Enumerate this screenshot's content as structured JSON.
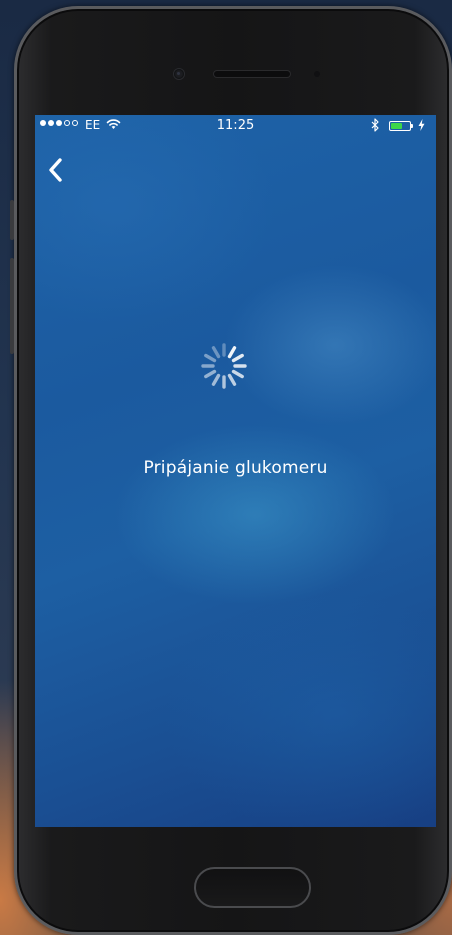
{
  "status_bar": {
    "signal_filled": 3,
    "signal_total": 5,
    "carrier": "EE",
    "time": "11:25",
    "battery_level": 0.6,
    "battery_color": "#3cd64a",
    "icons": [
      "wifi-icon",
      "bluetooth-icon",
      "battery-icon",
      "charging-bolt-icon"
    ]
  },
  "nav": {
    "back_icon": "chevron-left-icon"
  },
  "main": {
    "spinner_icon": "loading-spinner-icon",
    "status_text": "Pripájanie glukomeru"
  },
  "colors": {
    "screen_blue": "#1d5fa3",
    "text": "#ffffff"
  }
}
